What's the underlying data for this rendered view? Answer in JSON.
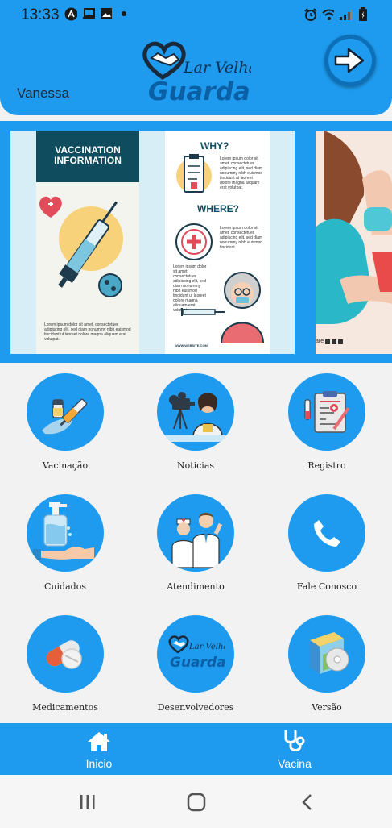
{
  "status_bar": {
    "time": "13:33",
    "left_icons": [
      "a-circle-icon",
      "laptop-icon",
      "image-icon",
      "dot-icon"
    ],
    "right_icons": [
      "alarm-icon",
      "wifi-icon",
      "signal-icon",
      "battery-icon"
    ]
  },
  "header": {
    "username": "Vanessa",
    "logo": {
      "line1": "Lar Velha",
      "line2": "Guarda"
    },
    "logout_icon": "logout-arrow-icon"
  },
  "banner": {
    "slides": [
      {
        "panel1_title_line1": "VACCINATION",
        "panel1_title_line2": "INFORMATION",
        "panel1_text": "Lorem ipsum dolor sit amet, consectetuer adipiscing elit, sed diam nonummy nibh euismod tincidunt ut laoreet dolore magna aliquam erat volutpat.",
        "panel2_heading1": "WHY?",
        "panel2_text1": "Lorem ipsum dolor sit amet, consectetuer adipiscing elit, sed diam nonummy nibh euismod tincidunt ut laoreet dolore magna aliquam erat volutpat.",
        "panel2_heading2": "WHERE?",
        "panel2_text2": "Lorem ipsum dolor sit amet, consectetuer adipiscing elit, sed diam nonummy nibh euismod tincidunt.",
        "panel2_text3": "Lorem ipsum dolor sit amet, consectetuer adipiscing elit, sed diam nonummy nibh euismod tincidunt ut laoreet dolore magna aliquam erat volutpat.",
        "panel2_footer": "WWW.WEBSITE.COM"
      },
      {
        "share_text": "are"
      }
    ]
  },
  "menu": [
    {
      "label": "Vacinação",
      "icon": "vaccine-syringe-icon"
    },
    {
      "label": "Noticias",
      "icon": "news-reporter-icon"
    },
    {
      "label": "Registro",
      "icon": "clipboard-register-icon"
    },
    {
      "label": "Cuidados",
      "icon": "hand-sanitizer-icon"
    },
    {
      "label": "Atendimento",
      "icon": "doctor-nurse-icon"
    },
    {
      "label": "Fale Conosco",
      "icon": "phone-icon"
    },
    {
      "label": "Medicamentos",
      "icon": "pills-icon"
    },
    {
      "label": "Desenvolvedores",
      "icon": "lar-velha-guarda-logo-icon"
    },
    {
      "label": "Versão",
      "icon": "software-box-icon"
    }
  ],
  "tabs": [
    {
      "label": "Inicio",
      "icon": "home-icon"
    },
    {
      "label": "Vacina",
      "icon": "stethoscope-icon"
    }
  ],
  "colors": {
    "primary": "#1e9bee",
    "primary_dark": "#0d6fb8",
    "logo_text": "#0b5fa5",
    "heart": "#2a3a4a"
  }
}
